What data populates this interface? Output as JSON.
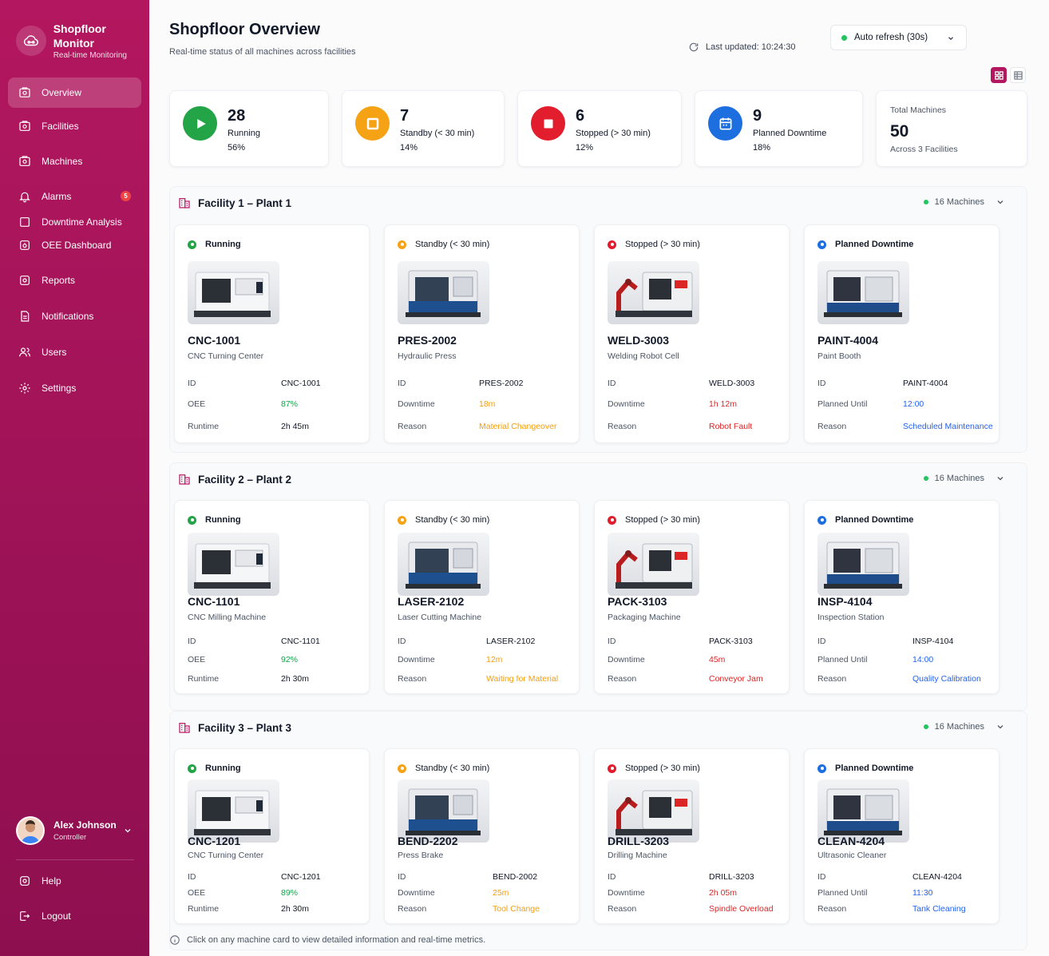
{
  "app": {
    "title": "Shopfloor Monitor",
    "subtitle": "Real-time Monitoring"
  },
  "sidebar": {
    "items": [
      {
        "label": "Overview",
        "icon": "overview-icon"
      },
      {
        "label": "Facilities",
        "icon": "facilities-icon"
      },
      {
        "label": "Machines",
        "icon": "machines-icon"
      },
      {
        "label": "Alarms",
        "icon": "bell-icon",
        "badge": "5"
      },
      {
        "label": "Downtime Analysis",
        "icon": "chart-icon"
      },
      {
        "label": "OEE Dashboard",
        "icon": "dashboard-icon"
      },
      {
        "label": "Reports",
        "icon": "report-icon"
      },
      {
        "label": "Notifications",
        "icon": "notification-icon"
      },
      {
        "label": "Users",
        "icon": "users-icon"
      },
      {
        "label": "Settings",
        "icon": "gear-icon"
      }
    ],
    "bottom": [
      {
        "label": "Help",
        "icon": "help-icon"
      },
      {
        "label": "Logout",
        "icon": "logout-icon"
      }
    ]
  },
  "user": {
    "name": "Alex Johnson",
    "role": "Controller"
  },
  "header": {
    "title": "Shopfloor Overview",
    "subtitle": "Real-time status of all machines across facilities",
    "last_updated": "Last updated: 10:24:30",
    "refresh_label": "Auto refresh (30s)"
  },
  "colors": {
    "running": "#22c55e",
    "standby": "#f59e0b",
    "stopped": "#dc2626",
    "planned": "#2563eb",
    "brand": "#b3175f"
  },
  "stats": [
    {
      "value": "28",
      "label": "Running",
      "pct": "56%"
    },
    {
      "value": "7",
      "label": "Standby (< 30 min)",
      "pct": "14%"
    },
    {
      "value": "6",
      "label": "Stopped (> 30 min)",
      "pct": "12%"
    },
    {
      "value": "9",
      "label": "Planned Downtime",
      "pct": "18%"
    }
  ],
  "total": {
    "label": "Total Machines",
    "value": "50",
    "sub": "Across 3 Facilities"
  },
  "facilities": [
    {
      "title": "Facility 1 – Plant 1",
      "count": "16 Machines",
      "cards": [
        {
          "status": "Running",
          "name": "CNC-1001",
          "type": "CNC Turning Center",
          "rows": [
            {
              "label": "ID",
              "value": "CNC-1001"
            },
            {
              "label": "OEE",
              "value": "87%"
            },
            {
              "label": "Runtime",
              "value": "2h 45m"
            }
          ]
        },
        {
          "status": "Standby (< 30 min)",
          "name": "PRES-2002",
          "type": "Hydraulic Press",
          "rows": [
            {
              "label": "ID",
              "value": "PRES-2002"
            },
            {
              "label": "Downtime",
              "value": "18m"
            },
            {
              "label": "Reason",
              "value": "Material Changeover"
            }
          ]
        },
        {
          "status": "Stopped (> 30 min)",
          "name": "WELD-3003",
          "type": "Welding Robot Cell",
          "rows": [
            {
              "label": "ID",
              "value": "WELD-3003"
            },
            {
              "label": "Downtime",
              "value": "1h 12m"
            },
            {
              "label": "Reason",
              "value": "Robot Fault"
            }
          ]
        },
        {
          "status": "Planned Downtime",
          "name": "PAINT-4004",
          "type": "Paint Booth",
          "rows": [
            {
              "label": "ID",
              "value": "PAINT-4004"
            },
            {
              "label": "Planned Until",
              "value": "12:00"
            },
            {
              "label": "Reason",
              "value": "Scheduled Maintenance"
            }
          ]
        }
      ]
    },
    {
      "title": "Facility 2 – Plant 2",
      "count": "16 Machines",
      "cards": [
        {
          "status": "Running",
          "name": "CNC-1101",
          "type": "CNC Milling Machine",
          "rows": [
            {
              "label": "ID",
              "value": "CNC-1101"
            },
            {
              "label": "OEE",
              "value": "92%"
            },
            {
              "label": "Runtime",
              "value": "2h 30m"
            }
          ]
        },
        {
          "status": "Standby (< 30 min)",
          "name": "LASER-2102",
          "type": "Laser Cutting Machine",
          "rows": [
            {
              "label": "ID",
              "value": "LASER-2102"
            },
            {
              "label": "Downtime",
              "value": "12m"
            },
            {
              "label": "Reason",
              "value": "Waiting for Material"
            }
          ]
        },
        {
          "status": "Stopped (> 30 min)",
          "name": "PACK-3103",
          "type": "Packaging Machine",
          "rows": [
            {
              "label": "ID",
              "value": "PACK-3103"
            },
            {
              "label": "Downtime",
              "value": "45m"
            },
            {
              "label": "Reason",
              "value": "Conveyor Jam"
            }
          ]
        },
        {
          "status": "Planned Downtime",
          "name": "INSP-4104",
          "type": "Inspection Station",
          "rows": [
            {
              "label": "ID",
              "value": "INSP-4104"
            },
            {
              "label": "Planned Until",
              "value": "14:00"
            },
            {
              "label": "Reason",
              "value": "Quality Calibration"
            }
          ]
        }
      ]
    },
    {
      "title": "Facility 3 – Plant 3",
      "count": "16 Machines",
      "cards": [
        {
          "status": "Running",
          "name": "CNC-1201",
          "type": "CNC Turning Center",
          "rows": [
            {
              "label": "ID",
              "value": "CNC-1201"
            },
            {
              "label": "OEE",
              "value": "89%"
            },
            {
              "label": "Runtime",
              "value": "2h 30m"
            }
          ]
        },
        {
          "status": "Standby (< 30 min)",
          "name": "BEND-2202",
          "type": "Press Brake",
          "rows": [
            {
              "label": "ID",
              "value": "BEND-2002"
            },
            {
              "label": "Downtime",
              "value": "25m"
            },
            {
              "label": "Reason",
              "value": "Tool Change"
            }
          ]
        },
        {
          "status": "Stopped (> 30 min)",
          "name": "DRILL-3203",
          "type": "Drilling Machine",
          "rows": [
            {
              "label": "ID",
              "value": "DRILL-3203"
            },
            {
              "label": "Downtime",
              "value": "2h 05m"
            },
            {
              "label": "Reason",
              "value": "Spindle Overload"
            }
          ]
        },
        {
          "status": "Planned Downtime",
          "name": "CLEAN-4204",
          "type": "Ultrasonic Cleaner",
          "rows": [
            {
              "label": "ID",
              "value": "CLEAN-4204"
            },
            {
              "label": "Planned Until",
              "value": "11:30"
            },
            {
              "label": "Reason",
              "value": "Tank Cleaning"
            }
          ]
        }
      ]
    }
  ],
  "footer_note": "Click on any machine card to view detailed information and real-time metrics."
}
